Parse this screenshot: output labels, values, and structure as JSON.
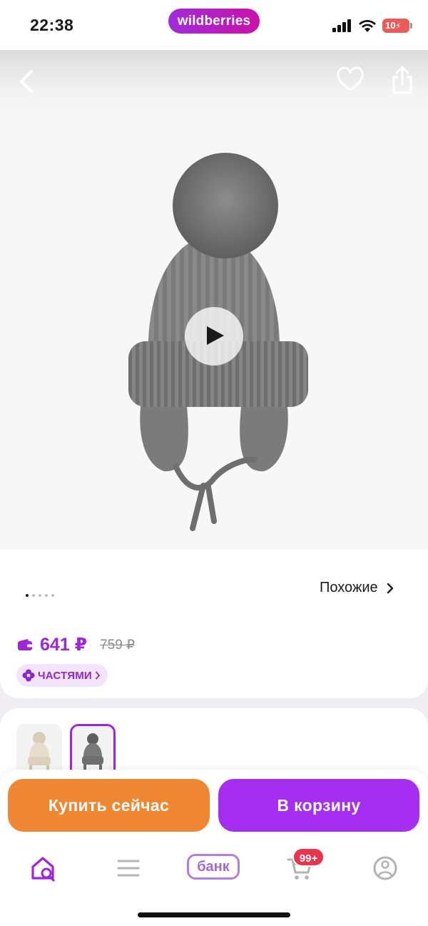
{
  "status_bar": {
    "time": "22:38",
    "brand": "wildberries",
    "battery": "10"
  },
  "gallery": {
    "image_alt": "knitted-grey-pompom-hat",
    "slides_total": 5,
    "active_slide": 1
  },
  "product": {
    "similar_label": "Похожие",
    "price": "641 ₽",
    "old_price": "759 ₽",
    "installments_label": "ЧАСТЯМИ"
  },
  "variants": [
    {
      "name": "beige",
      "color": "#e8dccb",
      "selected": false
    },
    {
      "name": "grey",
      "color": "#6b6b6b",
      "selected": true
    }
  ],
  "actions": {
    "buy_now": "Купить сейчас",
    "add_to_cart": "В корзину"
  },
  "nav": {
    "bank_label": "банк",
    "cart_badge": "99+"
  },
  "colors": {
    "brand_purple": "#a026dd",
    "buy_orange": "#ef8732",
    "cart_purple": "#a52ef0",
    "badge_red": "#e9344d"
  }
}
